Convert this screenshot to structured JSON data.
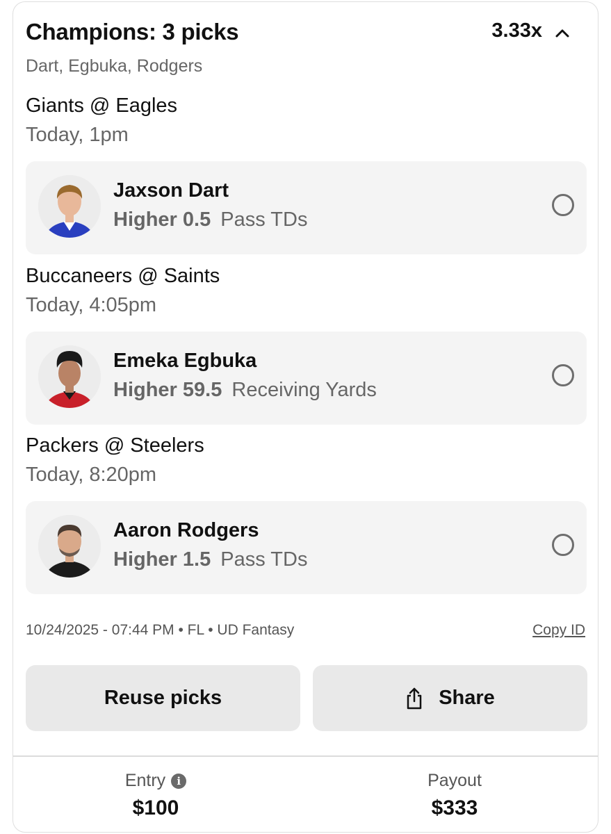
{
  "entry_card": {
    "title": "Champions: 3 picks",
    "multiplier": "3.33x",
    "players_summary": "Dart, Egbuka, Rodgers",
    "collapse_icon": "chevron-up-icon"
  },
  "picks": [
    {
      "matchup": "Giants @ Eagles",
      "time": "Today, 1pm",
      "player": "Jaxson Dart",
      "direction": "Higher",
      "line": "0.5",
      "stat": "Pass TDs",
      "jersey_color": "#2a3fbf",
      "hair_color": "#9a6a2e",
      "skin_color": "#e8b89a"
    },
    {
      "matchup": "Buccaneers @ Saints",
      "time": "Today, 4:05pm",
      "player": "Emeka Egbuka",
      "direction": "Higher",
      "line": "59.5",
      "stat": "Receiving Yards",
      "jersey_color": "#c8202a",
      "hair_color": "#1a1a1a",
      "skin_color": "#b98366"
    },
    {
      "matchup": "Packers @ Steelers",
      "time": "Today, 8:20pm",
      "player": "Aaron Rodgers",
      "direction": "Higher",
      "line": "1.5",
      "stat": "Pass TDs",
      "jersey_color": "#1b1b1b",
      "hair_color": "#4a3a30",
      "skin_color": "#d9a98a"
    }
  ],
  "meta": {
    "info": "10/24/2025 - 07:44 PM • FL • UD Fantasy",
    "copy_id": "Copy ID"
  },
  "actions": {
    "reuse_label": "Reuse picks",
    "share_label": "Share"
  },
  "footer": {
    "entry_label": "Entry",
    "entry_value": "$100",
    "payout_label": "Payout",
    "payout_value": "$333"
  }
}
